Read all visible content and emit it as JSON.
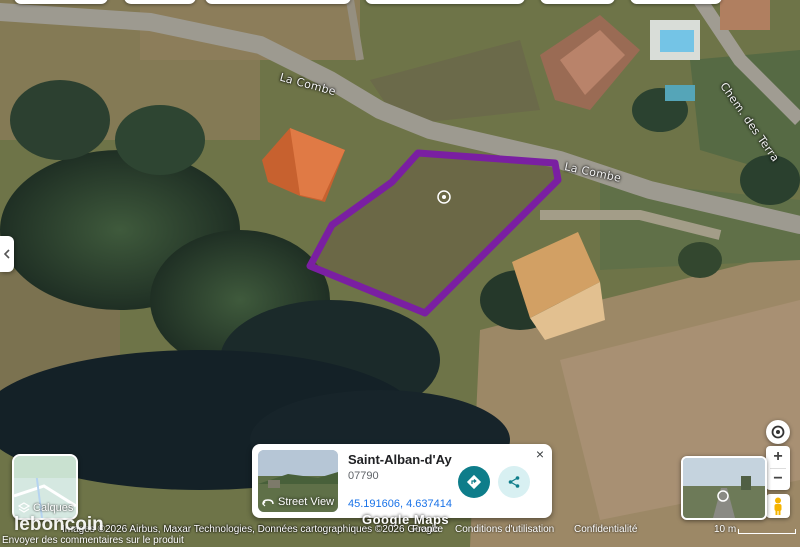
{
  "map": {
    "roads": [
      "La Combe",
      "La Combe",
      "Chem. des Terra"
    ],
    "parcel_outline_color": "#7a1fa2"
  },
  "controls": {
    "layers": {
      "label": "Calques",
      "icon": "layers-icon"
    },
    "compass_icon": "compass-icon",
    "zoom_in": "+",
    "zoom_out": "−",
    "pegman_icon": "pegman-icon",
    "collapse_icon": "chevron-left-icon"
  },
  "place_card": {
    "name": "Saint-Alban-d'Ay",
    "postcode": "07790",
    "coordinates": "45.191606, 4.637414",
    "street_view_label": "Street View",
    "close": "×",
    "directions_icon": "directions-icon",
    "share_icon": "share-icon"
  },
  "footer": {
    "attribution": "Images ©2026 Airbus, Maxar Technologies, Données cartographiques ©2026 Google",
    "country": "France",
    "terms": "Conditions d'utilisation",
    "privacy": "Confidentialité",
    "scale": "10 m",
    "feedback": "Envoyer des commentaires sur le produit",
    "google_logo": "Google Maps",
    "watermark": "leboncoin"
  }
}
